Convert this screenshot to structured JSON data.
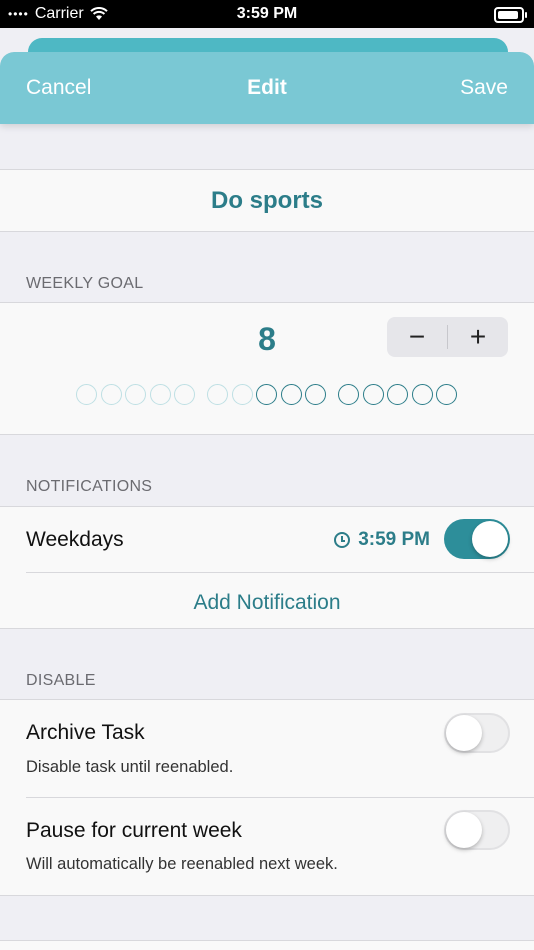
{
  "status_bar": {
    "carrier": "Carrier",
    "time": "3:59 PM"
  },
  "nav": {
    "cancel_label": "Cancel",
    "title": "Edit",
    "save_label": "Save"
  },
  "task": {
    "name": "Do sports"
  },
  "weekly_goal": {
    "section_label": "WEEKLY GOAL",
    "value": "8",
    "decrement_symbol": "−",
    "increment_symbol": "+",
    "total_circles": 15,
    "filled_circles": [
      8,
      9,
      10,
      11,
      12,
      13,
      14,
      15
    ]
  },
  "notifications": {
    "section_label": "NOTIFICATIONS",
    "items": [
      {
        "label": "Weekdays",
        "time": "3:59 PM",
        "enabled": true
      }
    ],
    "add_label": "Add Notification"
  },
  "disable": {
    "section_label": "DISABLE",
    "archive": {
      "title": "Archive Task",
      "subtitle": "Disable task until reenabled.",
      "enabled": false
    },
    "pause": {
      "title": "Pause for current week",
      "subtitle": "Will automatically be reenabled next week.",
      "enabled": false
    }
  },
  "colors": {
    "accent": "#2c7d89",
    "nav_background": "#7ac8d4",
    "toggle_on": "#2d8e9a"
  }
}
